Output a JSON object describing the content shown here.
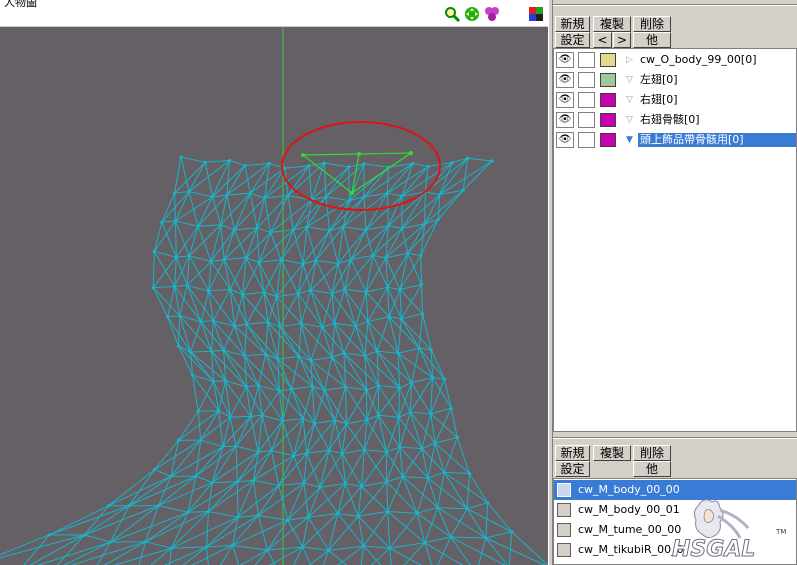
{
  "viewport": {
    "title_partial": "人物圖",
    "toolbar_icons": [
      "zoom-icon",
      "move-icon",
      "rotate-icon",
      "color-grid-icon"
    ]
  },
  "frames_panel": {
    "buttons_row1": [
      "新規",
      "複製",
      "削除"
    ],
    "buttons_row2": [
      "設定",
      "<",
      ">",
      "他"
    ],
    "items": [
      {
        "label": "cw_O_body_99_00[0]",
        "color": "#e0dc8c",
        "selected": false,
        "expanded": false
      },
      {
        "label": "左翅[0]",
        "color": "#9cc89c",
        "selected": false,
        "expanded": true
      },
      {
        "label": "右翅[0]",
        "color": "#c800b4",
        "selected": false,
        "expanded": true
      },
      {
        "label": "右翅骨骸[0]",
        "color": "#c800b4",
        "selected": false,
        "expanded": true
      },
      {
        "label": "頭上飾品帶骨骸用[0]",
        "color": "#c800b4",
        "selected": true,
        "expanded": true
      }
    ]
  },
  "materials_panel": {
    "buttons_row1": [
      "新規",
      "複製",
      "削除"
    ],
    "buttons_row2": [
      "設定",
      "他"
    ],
    "items": [
      {
        "label": "cw_M_body_00_00",
        "selected": true
      },
      {
        "label": "cw_M_body_00_01",
        "selected": false
      },
      {
        "label": "cw_M_tume_00_00",
        "selected": false
      },
      {
        "label": "cw_M_tikubiR_00_0",
        "selected": false
      }
    ]
  },
  "colors": {
    "viewport_bg": "#646066",
    "mesh": "#19b4c8",
    "selected_mesh": "#32dc32",
    "highlight_ring": "#dc1414",
    "axis": "#3cc83c",
    "selection": "#3a7bd5"
  },
  "watermark": {
    "text": "HSGAL",
    "tm": "TM"
  }
}
